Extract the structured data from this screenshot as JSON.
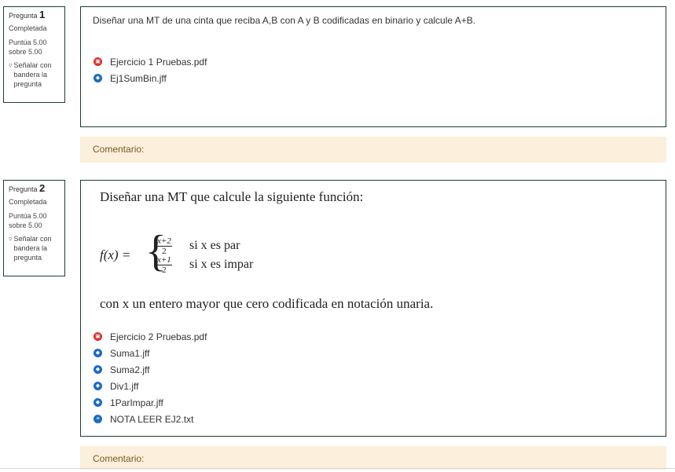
{
  "questions": [
    {
      "label": "Pregunta",
      "number": "1",
      "state": "Completada",
      "grade": "Puntúa 5.00 sobre 5.00",
      "flag": "Señalar con bandera la pregunta",
      "text": "Diseñar una MT de una cinta que reciba A,B con A y B codificadas en binario y calcule A+B.",
      "attachments": [
        {
          "icon": "pdf-file-icon",
          "name": "Ejercicio 1 Pruebas.pdf"
        },
        {
          "icon": "code-file-icon",
          "name": "Ej1SumBin.jff"
        }
      ],
      "comment": "Comentario:"
    },
    {
      "label": "Pregunta",
      "number": "2",
      "state": "Completada",
      "grade": "Puntúa 5.00 sobre 5.00",
      "flag": "Señalar con bandera la pregunta",
      "text": "Diseñar una MT que calcule la siguiente función:",
      "formula": {
        "lhs": "f(x) =",
        "case1_num": "x+2",
        "case1_den": "2",
        "case1_cond": "si x es par",
        "case2_num": "x+1",
        "case2_den": "2",
        "case2_cond": "si x es impar"
      },
      "text2": "con x un entero mayor que cero codificada en notación unaria.",
      "attachments": [
        {
          "icon": "pdf-file-icon",
          "name": "Ejercicio 2 Pruebas.pdf"
        },
        {
          "icon": "code-file-icon",
          "name": "Suma1.jff"
        },
        {
          "icon": "code-file-icon",
          "name": "Suma2.jff"
        },
        {
          "icon": "code-file-icon",
          "name": "Div1.jff"
        },
        {
          "icon": "code-file-icon",
          "name": "1ParImpar.jff"
        },
        {
          "icon": "text-file-icon",
          "name": "NOTA LEER EJ2.txt"
        }
      ],
      "comment": "Comentario:"
    }
  ]
}
